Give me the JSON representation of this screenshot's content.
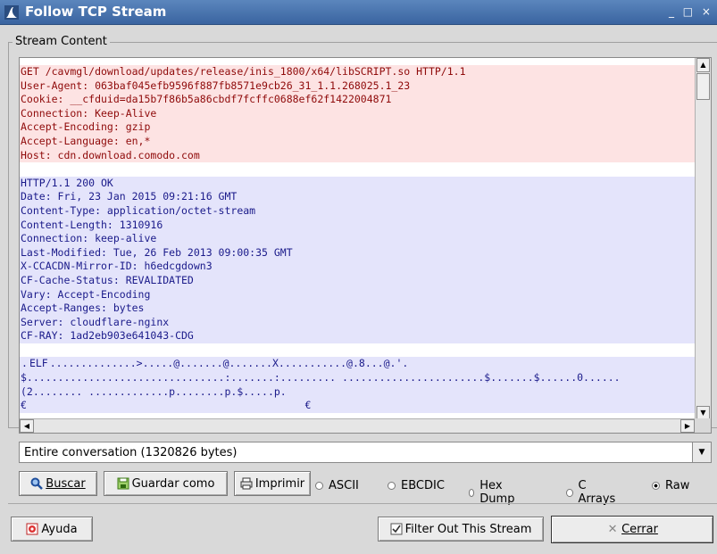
{
  "window": {
    "title": "Follow TCP Stream",
    "controls": "_ □ ×"
  },
  "stream": {
    "legend": "Stream Content",
    "request_lines": [
      "GET /cavmgl/download/updates/release/inis_1800/x64/libSCRIPT.so HTTP/1.1",
      "User-Agent: 063baf045efb9596f887fb8571e9cb26_31_1.1.268025.1_23",
      "Cookie: __cfduid=da15b7f86b5a86cbdf7fcffc0688ef62f1422004871",
      "Connection: Keep-Alive",
      "Accept-Encoding: gzip",
      "Accept-Language: en,*",
      "Host: cdn.download.comodo.com"
    ],
    "response_lines": [
      "HTTP/1.1 200 OK",
      "Date: Fri, 23 Jan 2015 09:21:16 GMT",
      "Content-Type: application/octet-stream",
      "Content-Length: 1310916",
      "Connection: keep-alive",
      "Last-Modified: Tue, 26 Feb 2013 09:00:35 GMT",
      "X-CCACDN-Mirror-ID: h6edcgdown3",
      "CF-Cache-Status: REVALIDATED",
      "Vary: Accept-Encoding",
      "Accept-Ranges: bytes",
      "Server: cloudflare-nginx",
      "CF-RAY: 1ad2eb903e641043-CDG"
    ],
    "binary_selected": "ELF",
    "binary_line1_prefix": ".",
    "binary_line1_rest": "..............>.....@.......@.......X...........@.8...@.'.",
    "binary_lines": [
      "$................................:.......:......... .......................$.......$......0......",
      "(2........ .............p........p.$.....p.",
      "€                                             €"
    ]
  },
  "conversation_select": {
    "value": "Entire conversation (1320826 bytes)"
  },
  "buttons": {
    "find": "Buscar",
    "save_as": "Guardar como",
    "print": "Imprimir",
    "help": "Ayuda",
    "filter_out": "Filter Out This Stream",
    "close": "Cerrar"
  },
  "format_options": [
    {
      "label": "ASCII",
      "selected": false
    },
    {
      "label": "EBCDIC",
      "selected": false
    },
    {
      "label": "Hex Dump",
      "selected": false
    },
    {
      "label": "C Arrays",
      "selected": false
    },
    {
      "label": "Raw",
      "selected": true
    }
  ],
  "colors": {
    "client_bg": "#fde3e3",
    "client_fg": "#8f0a0a",
    "server_bg": "#e4e4fb",
    "server_fg": "#1a1a8a",
    "title_bar": "#4a74ae"
  }
}
